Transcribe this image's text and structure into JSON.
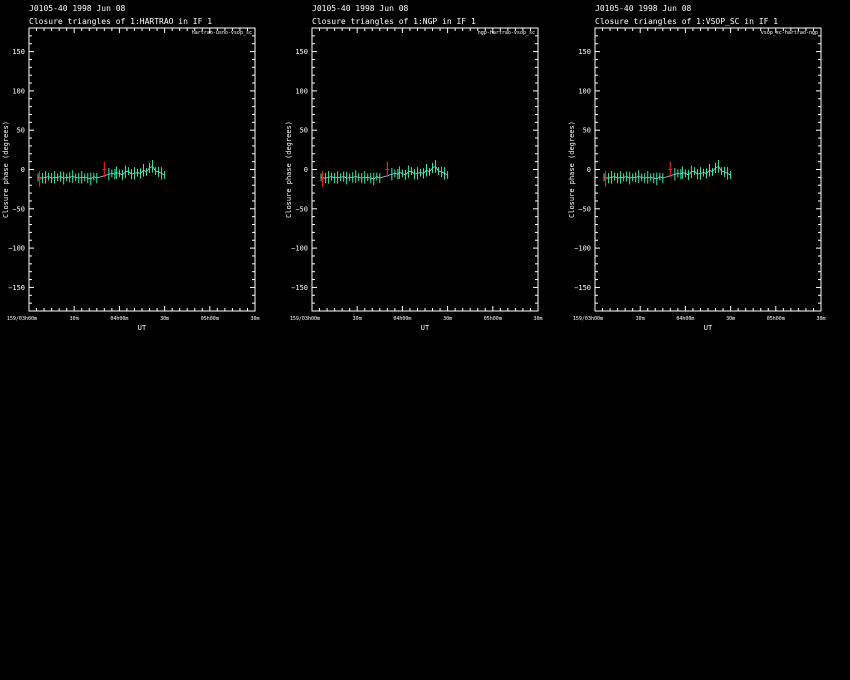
{
  "panels": [
    {
      "header1": "J0105-40   1998 Jun 08",
      "header2": "Closure triangles of 1:HARTRAO in IF 1",
      "triangle_tag": "hartrao-usno-vsop_sc"
    },
    {
      "header1": "J0105-40   1998 Jun 08",
      "header2": "Closure triangles of 1:NGP in IF 1",
      "triangle_tag": "ngp-hartrao-vsop_sc"
    },
    {
      "header1": "J0105-40   1998 Jun 08",
      "header2": "Closure triangles of 1:VSOP_SC in IF 1",
      "triangle_tag": "vsop_sc-hartrao-ngp"
    }
  ],
  "chart_data": [
    {
      "type": "scatter",
      "title": "Closure triangles of 1:HARTRAO in IF 1",
      "xlabel": "UT",
      "ylabel": "Closure phase   (degrees)",
      "ylim": [
        -180,
        180
      ],
      "yticks": [
        150,
        100,
        50,
        0,
        -50,
        -100,
        -150
      ],
      "ytick_labels": [
        "150",
        "100",
        "50",
        "0",
        "−50",
        "−100",
        "−150"
      ],
      "xlim_minutes": [
        0,
        150
      ],
      "xtick_labels": [
        {
          "t": 0,
          "label": "159/03h00m"
        },
        {
          "t": 30,
          "label": "30m"
        },
        {
          "t": 60,
          "label": "04h00m"
        },
        {
          "t": 90,
          "label": "30m"
        },
        {
          "t": 120,
          "label": "05h00m"
        },
        {
          "t": 150,
          "label": "30m"
        }
      ],
      "series": [
        {
          "points_minutes_deg": [
            [
              6,
              -10
            ],
            [
              9,
              -11
            ],
            [
              11,
              -10
            ],
            [
              13,
              -9
            ],
            [
              15,
              -11
            ],
            [
              17,
              -10
            ],
            [
              19,
              -10
            ],
            [
              21,
              -9
            ],
            [
              23,
              -11
            ],
            [
              25,
              -10
            ],
            [
              27,
              -10
            ],
            [
              29,
              -9
            ],
            [
              31,
              -10
            ],
            [
              33,
              -11
            ],
            [
              35,
              -10
            ],
            [
              37,
              -10
            ],
            [
              39,
              -11
            ],
            [
              41,
              -12
            ],
            [
              43,
              -9
            ],
            [
              45,
              -11
            ],
            [
              53,
              -6
            ],
            [
              55,
              -5
            ],
            [
              57,
              -6
            ],
            [
              58,
              -4
            ],
            [
              60,
              -5
            ],
            [
              62,
              -7
            ],
            [
              64,
              -3
            ],
            [
              66,
              -2
            ],
            [
              68,
              -6
            ],
            [
              70,
              -5
            ],
            [
              72,
              -4
            ],
            [
              74,
              -5
            ],
            [
              76,
              -1
            ],
            [
              78,
              -3
            ],
            [
              80,
              2
            ],
            [
              82,
              4
            ],
            [
              84,
              -2
            ],
            [
              86,
              -3
            ],
            [
              88,
              -5
            ],
            [
              90,
              -7
            ]
          ],
          "error_deg": 5
        }
      ],
      "flagged_points_minutes_deg": [
        [
          7,
          -12
        ],
        [
          50,
          0
        ]
      ]
    },
    {
      "type": "scatter",
      "title": "Closure triangles of 1:NGP in IF 1",
      "xlabel": "UT",
      "ylabel": "Closure phase   (degrees)",
      "ylim": [
        -180,
        180
      ],
      "yticks": [
        150,
        100,
        50,
        0,
        -50,
        -100,
        -150
      ],
      "ytick_labels": [
        "150",
        "100",
        "50",
        "0",
        "−50",
        "−100",
        "−150"
      ],
      "xlim_minutes": [
        0,
        150
      ],
      "xtick_labels": [
        {
          "t": 0,
          "label": "159/03h00m"
        },
        {
          "t": 30,
          "label": "30m"
        },
        {
          "t": 60,
          "label": "04h00m"
        },
        {
          "t": 90,
          "label": "30m"
        },
        {
          "t": 120,
          "label": "05h00m"
        },
        {
          "t": 150,
          "label": "30m"
        }
      ],
      "series": [
        {
          "points_minutes_deg": [
            [
              6,
              -10
            ],
            [
              9,
              -11
            ],
            [
              11,
              -10
            ],
            [
              13,
              -9
            ],
            [
              15,
              -11
            ],
            [
              17,
              -10
            ],
            [
              19,
              -10
            ],
            [
              21,
              -9
            ],
            [
              23,
              -11
            ],
            [
              25,
              -10
            ],
            [
              27,
              -10
            ],
            [
              29,
              -9
            ],
            [
              31,
              -10
            ],
            [
              33,
              -11
            ],
            [
              35,
              -10
            ],
            [
              37,
              -10
            ],
            [
              39,
              -11
            ],
            [
              41,
              -12
            ],
            [
              43,
              -9
            ],
            [
              45,
              -11
            ],
            [
              53,
              -6
            ],
            [
              55,
              -5
            ],
            [
              57,
              -6
            ],
            [
              58,
              -4
            ],
            [
              60,
              -5
            ],
            [
              62,
              -7
            ],
            [
              64,
              -3
            ],
            [
              66,
              -2
            ],
            [
              68,
              -6
            ],
            [
              70,
              -5
            ],
            [
              72,
              -4
            ],
            [
              74,
              -5
            ],
            [
              76,
              -1
            ],
            [
              78,
              -3
            ],
            [
              80,
              2
            ],
            [
              82,
              4
            ],
            [
              84,
              -2
            ],
            [
              86,
              -3
            ],
            [
              88,
              -5
            ],
            [
              90,
              -7
            ]
          ],
          "error_deg": 5
        }
      ],
      "flagged_points_minutes_deg": [
        [
          7,
          -12
        ],
        [
          50,
          0
        ]
      ]
    },
    {
      "type": "scatter",
      "title": "Closure triangles of 1:VSOP_SC in IF 1",
      "xlabel": "UT",
      "ylabel": "Closure phase   (degrees)",
      "ylim": [
        -180,
        180
      ],
      "yticks": [
        150,
        100,
        50,
        0,
        -50,
        -100,
        -150
      ],
      "ytick_labels": [
        "150",
        "100",
        "50",
        "0",
        "−50",
        "−100",
        "−150"
      ],
      "xlim_minutes": [
        0,
        150
      ],
      "xtick_labels": [
        {
          "t": 0,
          "label": "159/03h00m"
        },
        {
          "t": 30,
          "label": "30m"
        },
        {
          "t": 60,
          "label": "04h00m"
        },
        {
          "t": 90,
          "label": "30m"
        },
        {
          "t": 120,
          "label": "05h00m"
        },
        {
          "t": 150,
          "label": "30m"
        }
      ],
      "series": [
        {
          "points_minutes_deg": [
            [
              6,
              -10
            ],
            [
              9,
              -11
            ],
            [
              11,
              -10
            ],
            [
              13,
              -9
            ],
            [
              15,
              -11
            ],
            [
              17,
              -10
            ],
            [
              19,
              -10
            ],
            [
              21,
              -9
            ],
            [
              23,
              -11
            ],
            [
              25,
              -10
            ],
            [
              27,
              -10
            ],
            [
              29,
              -9
            ],
            [
              31,
              -10
            ],
            [
              33,
              -11
            ],
            [
              35,
              -10
            ],
            [
              37,
              -10
            ],
            [
              39,
              -11
            ],
            [
              41,
              -12
            ],
            [
              43,
              -9
            ],
            [
              45,
              -11
            ],
            [
              53,
              -6
            ],
            [
              55,
              -5
            ],
            [
              57,
              -6
            ],
            [
              58,
              -4
            ],
            [
              60,
              -5
            ],
            [
              62,
              -7
            ],
            [
              64,
              -3
            ],
            [
              66,
              -2
            ],
            [
              68,
              -6
            ],
            [
              70,
              -5
            ],
            [
              72,
              -4
            ],
            [
              74,
              -5
            ],
            [
              76,
              -1
            ],
            [
              78,
              -3
            ],
            [
              80,
              2
            ],
            [
              82,
              4
            ],
            [
              84,
              -2
            ],
            [
              86,
              -3
            ],
            [
              88,
              -5
            ],
            [
              90,
              -7
            ]
          ],
          "error_deg": 5
        }
      ],
      "flagged_points_minutes_deg": [
        [
          7,
          -12
        ],
        [
          50,
          0
        ]
      ]
    }
  ],
  "colors": {
    "background": "#000000",
    "axes": "#ffffff",
    "data_points": "#3ee8a0",
    "model_line": "#9fd8ff",
    "flagged": "#e02020"
  }
}
